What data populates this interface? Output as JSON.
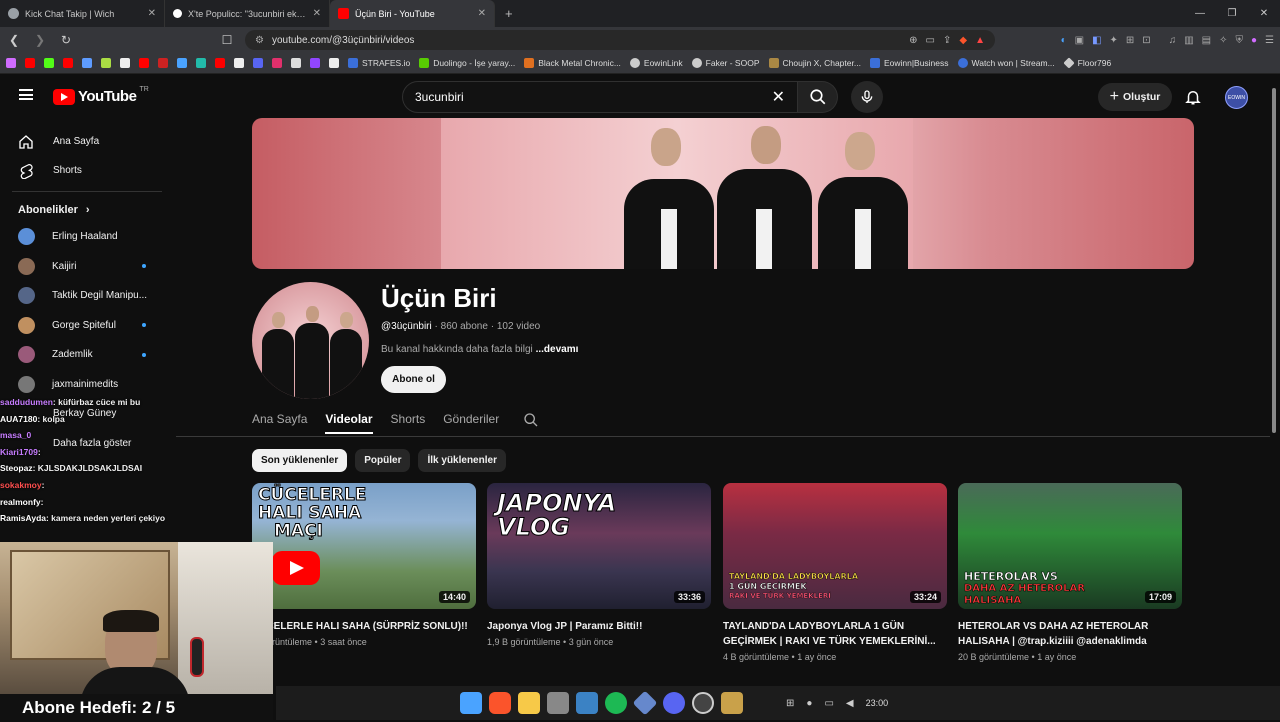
{
  "browser": {
    "tabs": [
      {
        "title": "Kick Chat Takip | Wich",
        "icon_color": "#9aa0a6"
      },
      {
        "title": "X'te Populicc: \"3ucunbiri ekibi, cüceler...",
        "icon_color": "#ffffff"
      },
      {
        "title": "Üçün Biri - YouTube",
        "icon_color": "#ff0000"
      }
    ],
    "new_tab": "+",
    "url": "youtube.com/@3üçünbiri/videos",
    "bookmarks": [
      {
        "label": "STRAFES.io",
        "color": "#3b6fd9"
      },
      {
        "label": "Duolingo - İşe yaray...",
        "color": "#58cc02"
      },
      {
        "label": "Black Metal Chronic...",
        "color": "#e07020"
      },
      {
        "label": "EowinLink",
        "color": "#cccccc"
      },
      {
        "label": "Faker - SOOP",
        "color": "#cccccc"
      },
      {
        "label": "Choujin X, Chapter...",
        "color": "#aa8844"
      },
      {
        "label": "Eowinn|Business",
        "color": "#3b6fd9"
      },
      {
        "label": "Watch won | Stream...",
        "color": "#3b6fd9"
      },
      {
        "label": "Floor796",
        "color": "#cccccc"
      }
    ]
  },
  "youtube": {
    "logo": "YouTube",
    "region": "TR",
    "search_value": "3ucunbiri",
    "create_label": "Oluştur",
    "avatar_text": "EOWIN",
    "sidebar": {
      "items": [
        {
          "label": "Ana Sayfa",
          "icon": "home-icon"
        },
        {
          "label": "Shorts",
          "icon": "shorts-icon"
        }
      ],
      "subs_header": "Abonelikler",
      "subscriptions": [
        {
          "name": "Erling Haaland",
          "color": "#5b8fd8",
          "dot": false
        },
        {
          "name": "Kaijiri",
          "color": "#8a6a55",
          "dot": true
        },
        {
          "name": "Taktik Degil Manipu...",
          "color": "#556688",
          "dot": false
        },
        {
          "name": "Gorge Spiteful",
          "color": "#c09060",
          "dot": true
        },
        {
          "name": "Zademlik",
          "color": "#9a5a7a",
          "dot": true
        },
        {
          "name": "jaxmainimedits",
          "color": "#777777",
          "dot": false
        },
        {
          "name": "Berkay Güney",
          "color": "#999999",
          "dot": false
        }
      ],
      "show_more": "Daha fazla göster"
    },
    "channel": {
      "name": "Üçün Biri",
      "handle": "@3üçünbiri",
      "subscribers": "860 abone",
      "videos": "102 video",
      "sep": "·",
      "desc": "Bu kanal hakkında daha fazla bilgi",
      "more": "...devamı",
      "subscribe": "Abone ol",
      "tabs": [
        "Ana Sayfa",
        "Videolar",
        "Shorts",
        "Gönderiler"
      ],
      "active_tab": "Videolar",
      "chips": [
        "Son yüklenenler",
        "Popüler",
        "İlk yüklenenler"
      ]
    },
    "videos": [
      {
        "title": "CÜCELERLE HALI SAHA (SÜRPRİZ SONLU)!!",
        "title2": "",
        "views": "... görüntüleme",
        "ago": "3 saat önce",
        "duration": "14:40",
        "thumb_lines": [
          "CÜCELERLE",
          "HALI SAHA",
          "MAÇI"
        ]
      },
      {
        "title": "Japonya Vlog JP | Paramız Bitti!!",
        "title2": "",
        "views": "1,9 B görüntüleme",
        "ago": "3 gün önce",
        "duration": "33:36",
        "thumb_lines": [
          "JAPONYA",
          "VLOG"
        ]
      },
      {
        "title": "TAYLAND'DA LADYBOYLARLA 1 GÜN",
        "title2": "GEÇİRMEK | RAKI VE TÜRK YEMEKLERİNİ...",
        "views": "4 B görüntüleme",
        "ago": "1 ay önce",
        "duration": "33:24",
        "thumb_lines": [
          "TAYLAND'DA LADYBOYLARLA",
          "1 GÜN GEÇİRMEK",
          "RAKI VE TÜRK YEMEKLERİ"
        ]
      },
      {
        "title": "HETEROLAR VS DAHA AZ HETEROLAR",
        "title2": "HALISAHA | @trap.kiziiii @adenaklimda",
        "views": "20 B görüntüleme",
        "ago": "1 ay önce",
        "duration": "17:09",
        "thumb_lines": [
          "HETEROLAR VS",
          "DAHA AZ HETEROLAR",
          "HALISAHA"
        ]
      }
    ]
  },
  "stream_overlay": {
    "chat": [
      {
        "user": "saddudumen",
        "msg": ": küfürbaz cüce mi bu",
        "color": "#c77dff"
      },
      {
        "user": "AUA7180",
        "msg": ": kolpa",
        "color": "#ffffff"
      },
      {
        "user": "masa_0",
        "msg": "",
        "color": "#c77dff"
      },
      {
        "user": "Kiari1709",
        "msg": ":",
        "color": "#c77dff"
      },
      {
        "user": "Steopaz",
        "msg": ": KJLSDAKJLDSAKJLDSAI",
        "color": "#ffffff"
      },
      {
        "user": "sokakmoy",
        "msg": ":",
        "color": "#ff4f4f"
      },
      {
        "user": "realmonfy",
        "msg": ":",
        "color": "#ffffff"
      },
      {
        "user": "RamisAyda",
        "msg": ": kamera neden yerleri çekiyo",
        "color": "#ffffff"
      }
    ],
    "goal": "Abone Hedefi:  2 / 5"
  },
  "taskbar": {
    "time": "23:00",
    "icons": [
      "windows-icon",
      "brave-icon",
      "folder-icon",
      "tool-icon",
      "photos-icon",
      "spotify-icon",
      "app-icon",
      "discord-icon",
      "obs-icon",
      "launcher-icon"
    ],
    "icon_colors": [
      "#4aa3ff",
      "#fb542b",
      "#f7c948",
      "#dddddd",
      "#3b82c4",
      "#1db954",
      "#6688cc",
      "#5865f2",
      "#888888",
      "#c9a14a"
    ]
  }
}
